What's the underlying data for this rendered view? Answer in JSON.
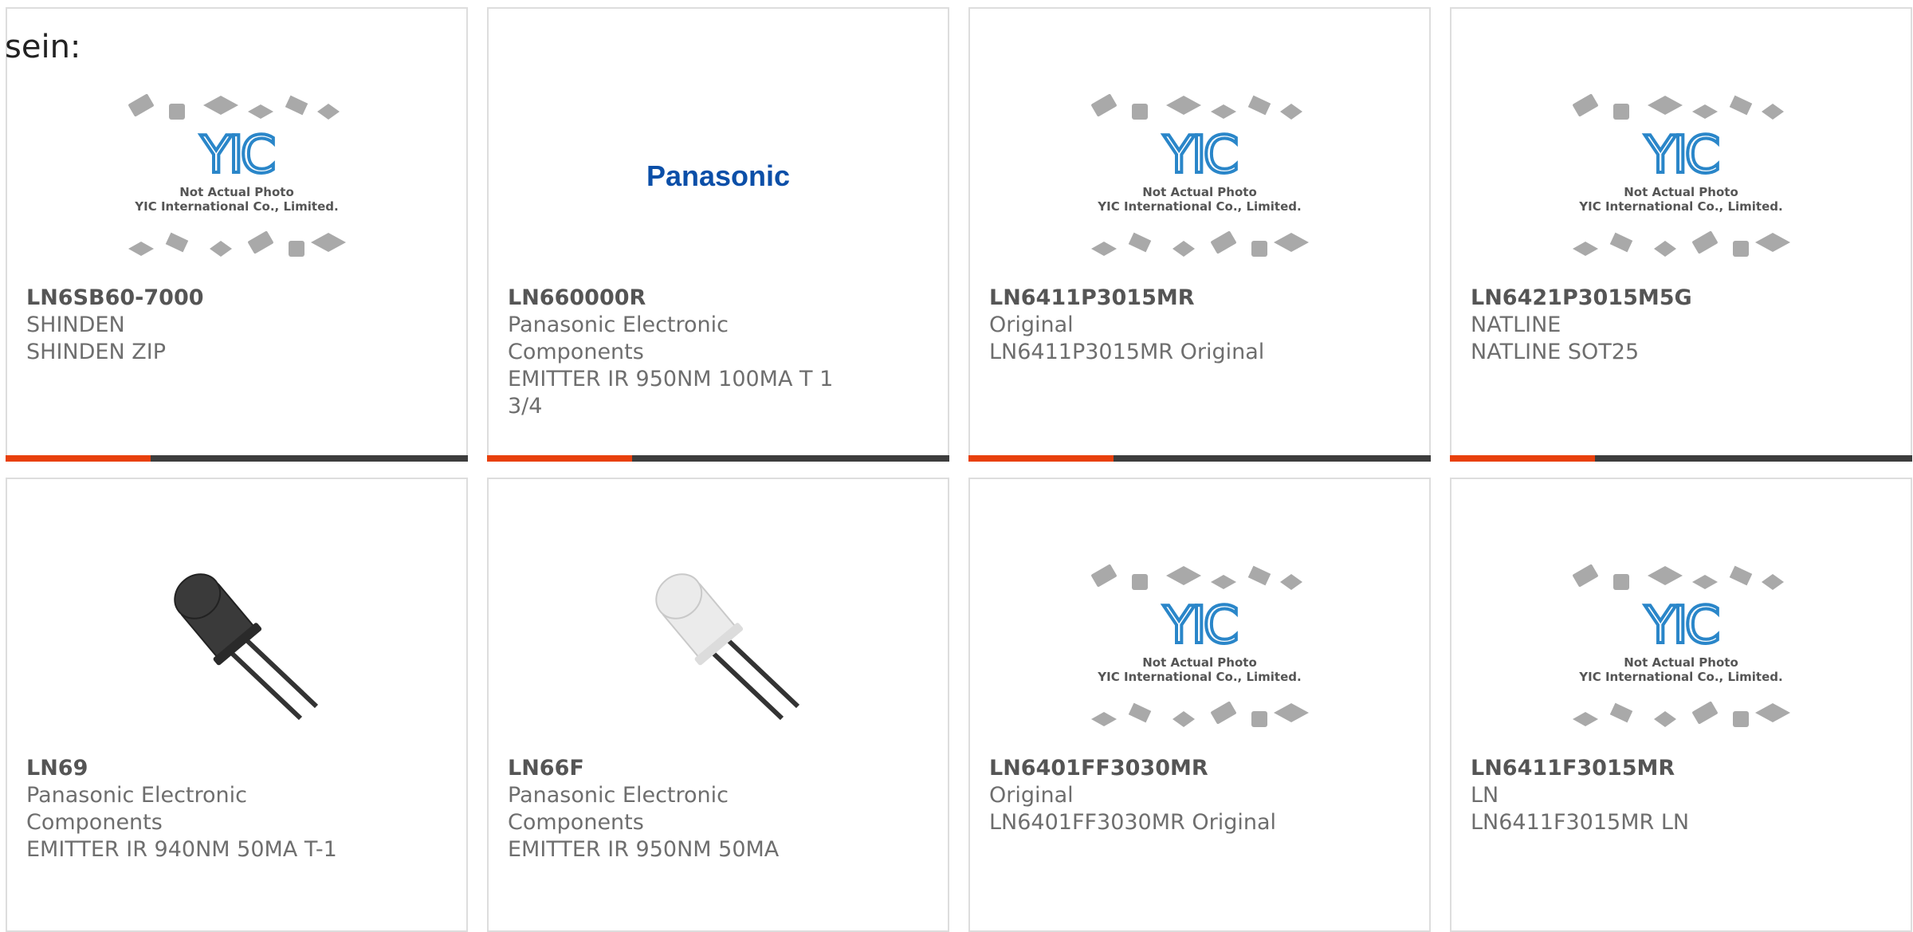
{
  "header": {
    "text": "sein:"
  },
  "placeholder": {
    "logo_text": "YIC",
    "line1": "Not Actual Photo",
    "line2": "YIC International Co., Limited."
  },
  "brand_logo": {
    "text": "Panasonic",
    "color": "#0b4fa8"
  },
  "colors": {
    "accent_bar": "#e8400c",
    "dark_bar": "#3d3d3d",
    "border": "#dddddd"
  },
  "cards": [
    {
      "part_number": "LN6SB60-7000",
      "manufacturer": "SHINDEN",
      "description": "SHINDEN ZIP",
      "image": "placeholder"
    },
    {
      "part_number": "LN660000R",
      "manufacturer": "Panasonic Electronic Components",
      "description": "EMITTER IR 950NM 100MA T 1 3/4",
      "image": "panasonic-logo"
    },
    {
      "part_number": "LN6411P3015MR",
      "manufacturer": "Original",
      "description": "LN6411P3015MR Original",
      "image": "placeholder"
    },
    {
      "part_number": "LN6421P3015M5G",
      "manufacturer": "NATLINE",
      "description": "NATLINE SOT25",
      "image": "placeholder"
    },
    {
      "part_number": "LN69",
      "manufacturer": "Panasonic Electronic Components",
      "description": "EMITTER IR 940NM 50MA T-1",
      "image": "led-dark"
    },
    {
      "part_number": "LN66F",
      "manufacturer": "Panasonic Electronic Components",
      "description": "EMITTER IR 950NM 50MA",
      "image": "led-clear"
    },
    {
      "part_number": "LN6401FF3030MR",
      "manufacturer": "Original",
      "description": "LN6401FF3030MR Original",
      "image": "placeholder"
    },
    {
      "part_number": "LN6411F3015MR",
      "manufacturer": "LN",
      "description": "LN6411F3015MR LN",
      "image": "placeholder"
    }
  ]
}
